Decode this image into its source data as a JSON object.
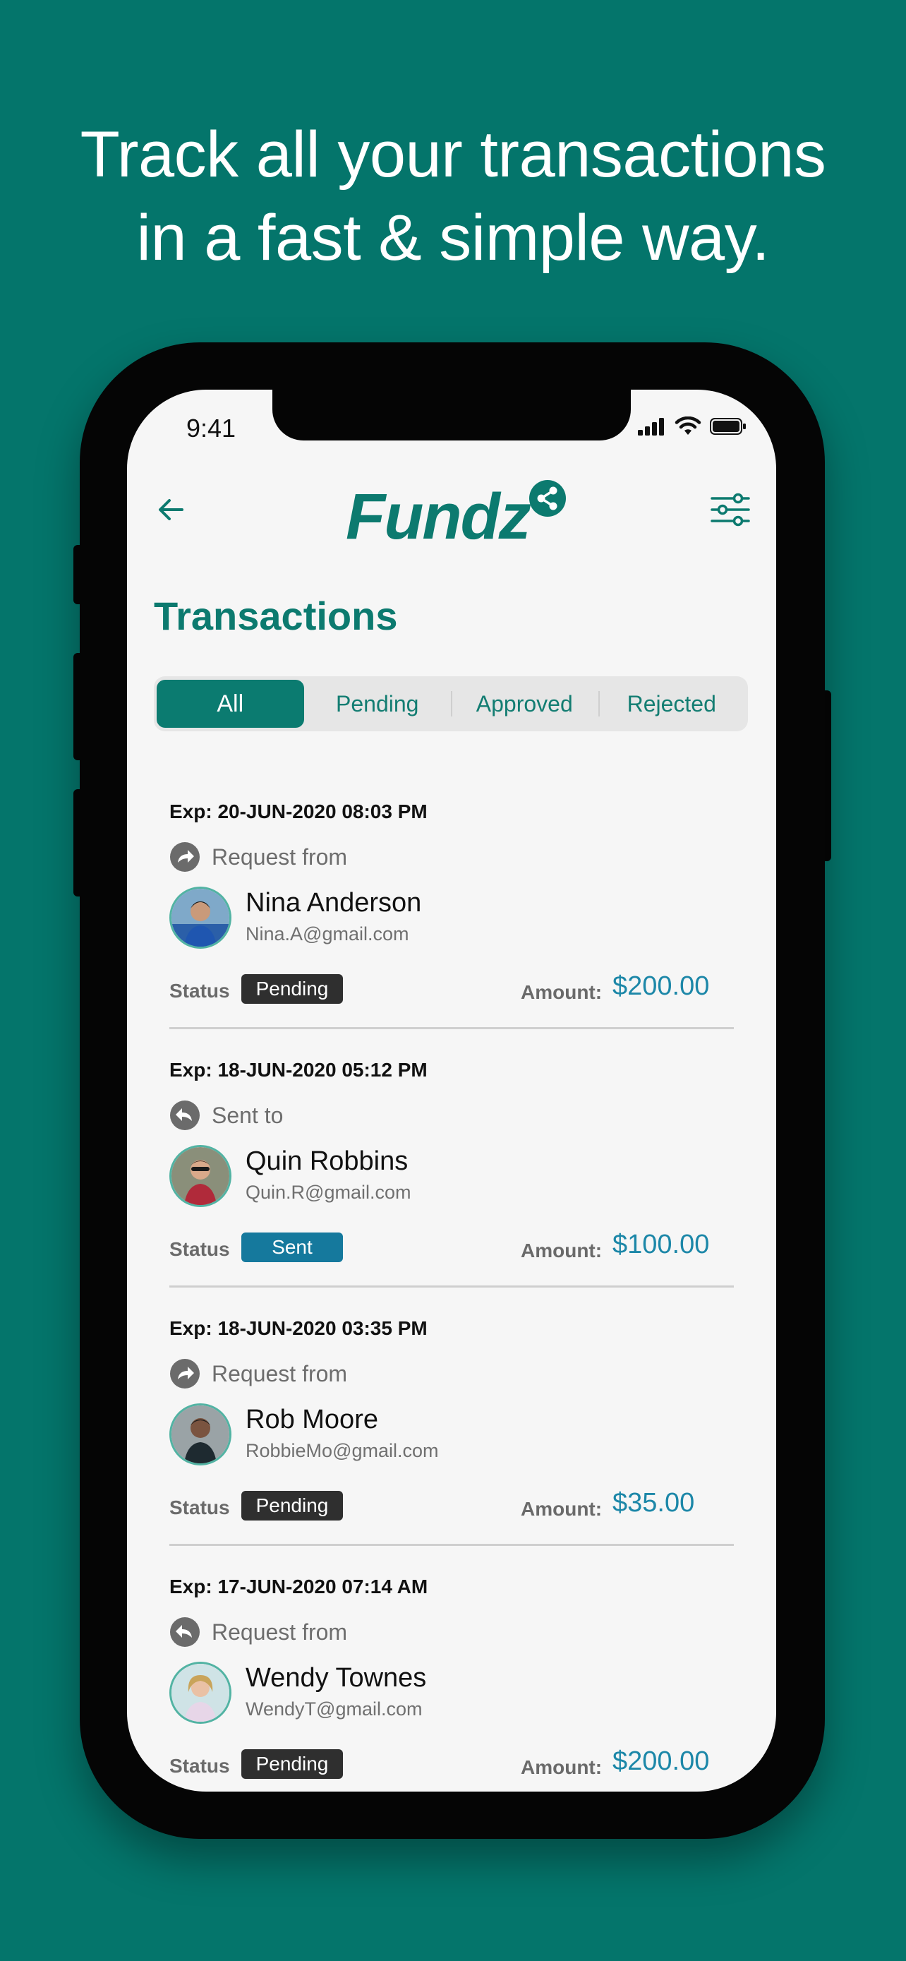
{
  "headline": {
    "line1": "Track all your transactions",
    "line2": "in a fast & simple way."
  },
  "status_bar": {
    "time": "9:41",
    "icons": [
      "signal-icon",
      "wifi-icon",
      "battery-icon"
    ]
  },
  "header": {
    "logo_text": "Fundz",
    "back_icon": "back-arrow-icon",
    "filter_icon": "filter-sliders-icon"
  },
  "page_title": "Transactions",
  "tabs": [
    {
      "label": "All",
      "active": true
    },
    {
      "label": "Pending",
      "active": false
    },
    {
      "label": "Approved",
      "active": false
    },
    {
      "label": "Rejected",
      "active": false
    }
  ],
  "transactions": [
    {
      "exp": "Exp: 20-JUN-2020 08:03 PM",
      "direction": "Request from",
      "direction_icon": "forward-arrow-icon",
      "name": "Nina Anderson",
      "email": "Nina.A@gmail.com",
      "status_label": "Status",
      "status": "Pending",
      "amount_label": "Amount:",
      "amount": "$200.00"
    },
    {
      "exp": "Exp: 18-JUN-2020 05:12 PM",
      "direction": "Sent to",
      "direction_icon": "reply-arrow-icon",
      "name": "Quin Robbins",
      "email": "Quin.R@gmail.com",
      "status_label": "Status",
      "status": "Sent",
      "amount_label": "Amount:",
      "amount": "$100.00"
    },
    {
      "exp": "Exp: 18-JUN-2020 03:35 PM",
      "direction": "Request from",
      "direction_icon": "forward-arrow-icon",
      "name": "Rob Moore",
      "email": "RobbieMo@gmail.com",
      "status_label": "Status",
      "status": "Pending",
      "amount_label": "Amount:",
      "amount": "$35.00"
    },
    {
      "exp": "Exp: 17-JUN-2020 07:14 AM",
      "direction": "Request from",
      "direction_icon": "reply-arrow-icon",
      "name": "Wendy Townes",
      "email": "WendyT@gmail.com",
      "status_label": "Status",
      "status": "Pending",
      "amount_label": "Amount:",
      "amount": "$200.00"
    }
  ],
  "colors": {
    "background": "#04756b",
    "brand": "#0c7a6f",
    "amount": "#1c87a8",
    "badge_pending": "#2f2f2f",
    "badge_sent": "#15799d"
  }
}
